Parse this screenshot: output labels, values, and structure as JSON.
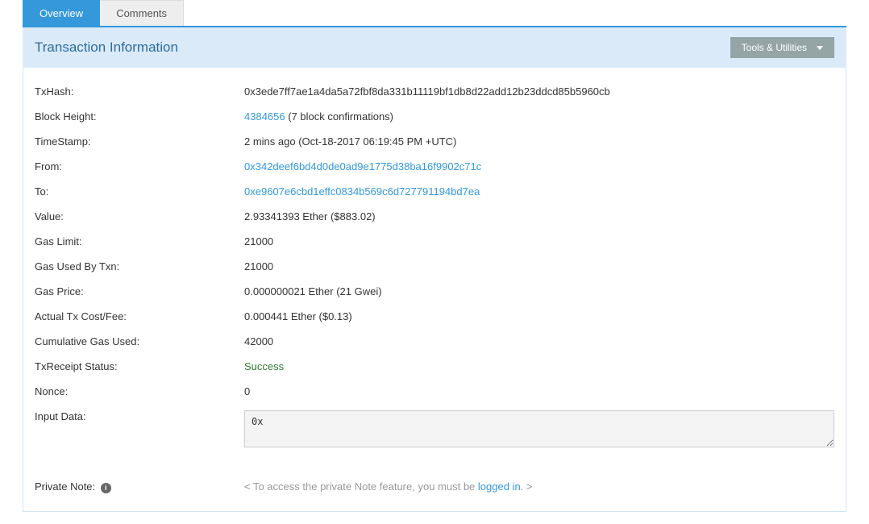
{
  "tabs": {
    "overview": "Overview",
    "comments": "Comments"
  },
  "panel_title": "Transaction Information",
  "tools_btn": "Tools & Utilities",
  "labels": {
    "txhash": "TxHash:",
    "block_height": "Block Height:",
    "timestamp": "TimeStamp:",
    "from": "From:",
    "to": "To:",
    "value": "Value:",
    "gas_limit": "Gas Limit:",
    "gas_used": "Gas Used By Txn:",
    "gas_price": "Gas Price:",
    "actual_cost": "Actual Tx Cost/Fee:",
    "cumulative_gas": "Cumulative Gas Used:",
    "receipt_status": "TxReceipt Status:",
    "nonce": "Nonce:",
    "input_data": "Input Data:",
    "private_note": "Private Note: "
  },
  "values": {
    "txhash": "0x3ede7ff7ae1a4da5a72fbf8da331b11119bf1db8d22add12b23ddcd85b5960cb",
    "block_height_link": "4384656",
    "block_height_suffix": " (7 block confirmations)",
    "timestamp": "2 mins ago (Oct-18-2017 06:19:45 PM +UTC)",
    "from": "0x342deef6bd4d0de0ad9e1775d38ba16f9902c71c",
    "to": "0xe9607e6cbd1effc0834b569c6d727791194bd7ea",
    "value": "2.93341393 Ether ($883.02)",
    "gas_limit": "21000",
    "gas_used": "21000",
    "gas_price": "0.000000021 Ether (21 Gwei)",
    "actual_cost": "0.000441 Ether ($0.13)",
    "cumulative_gas": "42000",
    "receipt_status": "Success",
    "nonce": "0",
    "input_data": "0x",
    "private_note_prefix": "< To access the private Note feature, you must be ",
    "private_note_link": "logged in",
    "private_note_suffix": ". >"
  }
}
